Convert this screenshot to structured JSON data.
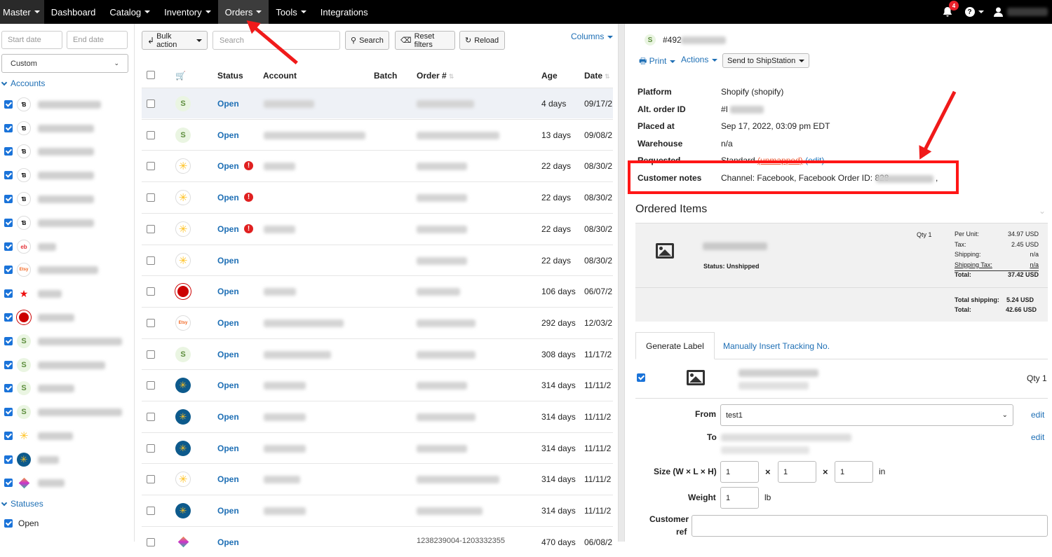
{
  "nav": {
    "master": "Master",
    "items": [
      "Dashboard",
      "Catalog",
      "Inventory",
      "Orders",
      "Tools",
      "Integrations"
    ],
    "notification_count": "4"
  },
  "sidebar": {
    "start_date_placeholder": "Start date",
    "end_date_placeholder": "End date",
    "range_value": "Custom",
    "accounts_heading": "Accounts",
    "statuses_heading": "Statuses",
    "status_open": "Open"
  },
  "toolbar": {
    "bulk_action": "Bulk action",
    "search_placeholder": "Search",
    "search_button": "Search",
    "reset_filters": "Reset filters",
    "reload": "Reload",
    "columns": "Columns"
  },
  "table": {
    "headers": {
      "status": "Status",
      "account": "Account",
      "batch": "Batch",
      "order": "Order #",
      "age": "Age",
      "date": "Date"
    },
    "rows": [
      {
        "platform": "shopify",
        "status": "Open",
        "warn": false,
        "age": "4 days",
        "date": "09/17/2"
      },
      {
        "platform": "shopify",
        "status": "Open",
        "warn": false,
        "age": "13 days",
        "date": "09/08/2"
      },
      {
        "platform": "walmart",
        "status": "Open",
        "warn": true,
        "age": "22 days",
        "date": "08/30/2"
      },
      {
        "platform": "walmart",
        "status": "Open",
        "warn": true,
        "age": "22 days",
        "date": "08/30/2"
      },
      {
        "platform": "walmart",
        "status": "Open",
        "warn": true,
        "age": "22 days",
        "date": "08/30/2"
      },
      {
        "platform": "walmart",
        "status": "Open",
        "warn": false,
        "age": "22 days",
        "date": "08/30/2"
      },
      {
        "platform": "target",
        "status": "Open",
        "warn": false,
        "age": "106 days",
        "date": "06/07/2"
      },
      {
        "platform": "etsy",
        "status": "Open",
        "warn": false,
        "age": "292 days",
        "date": "12/03/2"
      },
      {
        "platform": "shopify",
        "status": "Open",
        "warn": false,
        "age": "308 days",
        "date": "11/17/2"
      },
      {
        "platform": "walmart-ca",
        "status": "Open",
        "warn": false,
        "age": "314 days",
        "date": "11/11/2"
      },
      {
        "platform": "walmart-ca",
        "status": "Open",
        "warn": false,
        "age": "314 days",
        "date": "11/11/2"
      },
      {
        "platform": "walmart-ca",
        "status": "Open",
        "warn": false,
        "age": "314 days",
        "date": "11/11/2"
      },
      {
        "platform": "walmart",
        "status": "Open",
        "warn": false,
        "age": "314 days",
        "date": "11/11/2"
      },
      {
        "platform": "walmart-ca",
        "status": "Open",
        "warn": false,
        "age": "314 days",
        "date": "11/11/2"
      }
    ],
    "partial_row": {
      "status": "Open",
      "order": "1238239004-1203332355",
      "age": "470 days",
      "date": "06/08/2"
    }
  },
  "detail": {
    "order_number": "#492",
    "print": "Print",
    "actions": "Actions",
    "send_to": "Send to ShipStation",
    "fields": [
      {
        "label": "Platform",
        "value": "Shopify (shopify)"
      },
      {
        "label": "Alt. order ID",
        "value": "#I"
      },
      {
        "label": "Placed at",
        "value": "Sep 17, 2022, 03:09 pm EDT"
      },
      {
        "label": "Warehouse",
        "value": "n/a"
      }
    ],
    "requested_label": "Requested",
    "requested_value": "Standard",
    "requested_unmapped": "(unmapped)",
    "requested_edit": "(edit)",
    "customer_notes_label": "Customer notes",
    "customer_notes_value": "Channel: Facebook, Facebook Order ID: 828",
    "customer_notes_tail": ",",
    "ordered_items_heading": "Ordered Items",
    "item_status": "Status: Unshipped",
    "item_qty": "Qty 1",
    "pricing": [
      {
        "label": "Per Unit:",
        "value": "34.97 USD"
      },
      {
        "label": "Tax:",
        "value": "2.45 USD"
      },
      {
        "label": "Shipping:",
        "value": "n/a"
      },
      {
        "label": "Shipping Tax:",
        "value": "n/a"
      },
      {
        "label": "Total:",
        "value": "37.42 USD"
      }
    ],
    "total_shipping_label": "Total shipping:",
    "total_shipping_value": "5.24 USD",
    "grand_total_label": "Total:",
    "grand_total_value": "42.66 USD",
    "tabs": [
      "Generate Label",
      "Manually Insert Tracking No."
    ],
    "label_qty": "Qty 1",
    "from_label": "From",
    "from_value": "test1",
    "edit": "edit",
    "to_label": "To",
    "size_label": "Size (W × L × H)",
    "size_w": "1",
    "size_l": "1",
    "size_h": "1",
    "times": "×",
    "size_unit": "in",
    "weight_label": "Weight",
    "weight_value": "1",
    "weight_unit": "lb",
    "customer_ref_label_1": "Customer",
    "customer_ref_label_2": "ref"
  }
}
